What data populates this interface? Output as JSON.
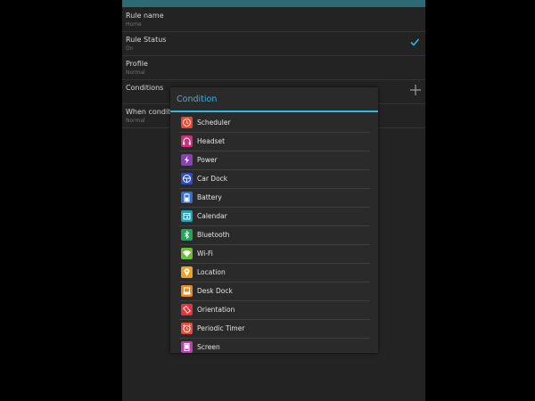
{
  "settings": {
    "rule_name": {
      "title": "Rule name",
      "value": "Home"
    },
    "rule_status": {
      "title": "Rule Status",
      "value": "On"
    },
    "profile": {
      "title": "Profile",
      "value": "Normal"
    },
    "conditions": {
      "title": "Conditions"
    },
    "when_condition": {
      "title": "When condition",
      "value": "Normal"
    }
  },
  "dialog": {
    "title": "Condition",
    "options": [
      {
        "label": "Scheduler",
        "icon": "clock-icon",
        "color": "#e8492f"
      },
      {
        "label": "Headset",
        "icon": "headset-icon",
        "color": "#cf2e7a"
      },
      {
        "label": "Power",
        "icon": "power-bolt-icon",
        "color": "#8b3fb6"
      },
      {
        "label": "Car Dock",
        "icon": "steering-wheel-icon",
        "color": "#2f4fc0"
      },
      {
        "label": "Battery",
        "icon": "battery-icon",
        "color": "#2f6fd6"
      },
      {
        "label": "Calendar",
        "icon": "calendar-icon",
        "color": "#21a0b6"
      },
      {
        "label": "Bluetooth",
        "icon": "bluetooth-icon",
        "color": "#1fa857"
      },
      {
        "label": "Wi-Fi",
        "icon": "wifi-icon",
        "color": "#6cbf36"
      },
      {
        "label": "Location",
        "icon": "location-pin-icon",
        "color": "#f0a21f"
      },
      {
        "label": "Desk Dock",
        "icon": "desk-dock-icon",
        "color": "#ef8a1d"
      },
      {
        "label": "Orientation",
        "icon": "orientation-icon",
        "color": "#e8333c"
      },
      {
        "label": "Periodic Timer",
        "icon": "alarm-clock-icon",
        "color": "#ea4a3a"
      },
      {
        "label": "Screen",
        "icon": "screen-icon",
        "color": "#b93fb5"
      }
    ]
  },
  "colors": {
    "accent": "#33b5e5",
    "dialog_bg": "#2a2a2a",
    "screen_bg": "#232323"
  }
}
